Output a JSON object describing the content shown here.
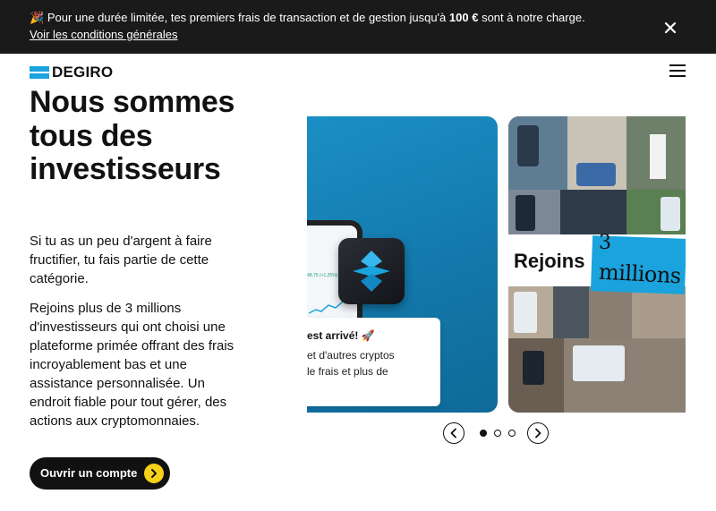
{
  "banner": {
    "emoji": "🎉",
    "text_before": "Pour une durée limitée, tes premiers frais de transaction et de gestion jusqu'à",
    "amount": "100 €",
    "text_after": "sont à notre charge.",
    "link": "Voir les conditions générales",
    "link_suffix": ".",
    "close_icon": "close-icon"
  },
  "header": {
    "logo_text": "DEGIRO",
    "brand_color": "#1aa3dd",
    "menu_icon": "hamburger-icon"
  },
  "hero": {
    "title": "Nous sommes tous des investisseurs",
    "paragraph1": "Si tu as un peu d'argent à faire fructifier, tu fais partie de cette catégorie.",
    "paragraph2": "Rejoins plus de 3 millions d'investisseurs qui ont choisi une plateforme primée offrant des frais incroyablement bas et une assistance personnalisée. Un endroit fiable pour tout gérer, des actions aux cryptomonnaies.",
    "cta_label": "Ouvrir un compte",
    "cta_icon": "chevron-right-icon",
    "cta_icon_color": "#f7d117"
  },
  "carousel": {
    "slide1": {
      "phone_text": "48,75 (+1,25%)",
      "card_title": "est arrivé! 🚀",
      "card_line1": "et d'autres cryptos",
      "card_line2": "le frais et plus de"
    },
    "slide2": {
      "join_text": "Rejoins",
      "count_text": "3",
      "millions_text": "millions"
    },
    "active_slide": 1,
    "slide_count": 3,
    "prev_icon": "chevron-left-icon",
    "next_icon": "chevron-right-icon"
  }
}
